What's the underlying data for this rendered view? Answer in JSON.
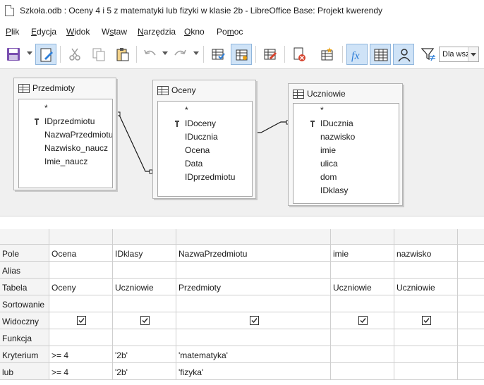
{
  "window": {
    "title": "Szkoła.odb : Oceny 4 i 5 z matematyki lub fizyki w klasie 2b - LibreOffice Base: Projekt kwerendy"
  },
  "menu": [
    {
      "label": "Plik",
      "mnemonic": "P",
      "rest": "lik"
    },
    {
      "label": "Edycja",
      "mnemonic": "E",
      "rest": "dycja"
    },
    {
      "label": "Widok",
      "mnemonic": "W",
      "rest": "idok"
    },
    {
      "label": "Wstaw",
      "mnemonic": "s",
      "pre": "W",
      "rest": "taw"
    },
    {
      "label": "Narzędzia",
      "mnemonic": "N",
      "rest": "arzędzia"
    },
    {
      "label": "Okno",
      "mnemonic": "O",
      "rest": "kno"
    },
    {
      "label": "Pomoc",
      "mnemonic": "m",
      "pre": "Po",
      "rest": "oc"
    }
  ],
  "toolbar": {
    "limit_value": "Dla wsz"
  },
  "tables": [
    {
      "name": "Przedmioty",
      "fields": [
        "*",
        "IDprzedmiotu",
        "NazwaPrzedmiotu",
        "Nazwisko_naucz",
        "Imie_naucz"
      ],
      "key_index": 1
    },
    {
      "name": "Oceny",
      "fields": [
        "*",
        "IDoceny",
        "IDucznia",
        "Ocena",
        "Data",
        "IDprzedmiotu"
      ],
      "key_index": 1
    },
    {
      "name": "Uczniowie",
      "fields": [
        "*",
        "IDucznia",
        "nazwisko",
        "imie",
        "ulica",
        "dom",
        "IDklasy"
      ],
      "key_index": 1
    }
  ],
  "grid": {
    "row_labels": [
      "Pole",
      "Alias",
      "Tabela",
      "Sortowanie",
      "Widoczny",
      "Funkcja",
      "Kryterium",
      "lub"
    ],
    "columns": [
      {
        "pole": "Ocena",
        "alias": "",
        "tabela": "Oceny",
        "sortowanie": "",
        "widoczny": true,
        "funkcja": "",
        "kryterium": ">= 4",
        "lub": ">= 4"
      },
      {
        "pole": "IDklasy",
        "alias": "",
        "tabela": "Uczniowie",
        "sortowanie": "",
        "widoczny": true,
        "funkcja": "",
        "kryterium": "'2b'",
        "lub": "'2b'"
      },
      {
        "pole": "NazwaPrzedmiotu",
        "alias": "",
        "tabela": "Przedmioty",
        "sortowanie": "",
        "widoczny": true,
        "funkcja": "",
        "kryterium": "'matematyka'",
        "lub": "'fizyka'"
      },
      {
        "pole": "imie",
        "alias": "",
        "tabela": "Uczniowie",
        "sortowanie": "",
        "widoczny": true,
        "funkcja": "",
        "kryterium": "",
        "lub": ""
      },
      {
        "pole": "nazwisko",
        "alias": "",
        "tabela": "Uczniowie",
        "sortowanie": "",
        "widoczny": true,
        "funkcja": "",
        "kryterium": "",
        "lub": ""
      },
      {
        "pole": "",
        "alias": "",
        "tabela": "",
        "sortowanie": "",
        "widoczny": false,
        "funkcja": "",
        "kryterium": "",
        "lub": ""
      }
    ]
  }
}
